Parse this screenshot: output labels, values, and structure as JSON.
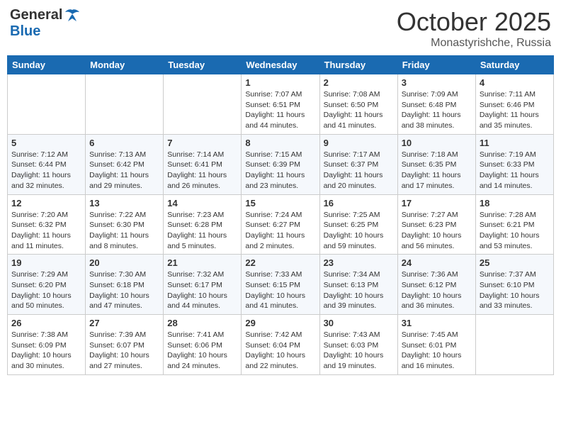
{
  "header": {
    "logo_general": "General",
    "logo_blue": "Blue",
    "month": "October 2025",
    "location": "Monastyrishche, Russia"
  },
  "days_of_week": [
    "Sunday",
    "Monday",
    "Tuesday",
    "Wednesday",
    "Thursday",
    "Friday",
    "Saturday"
  ],
  "weeks": [
    [
      {
        "day": "",
        "info": ""
      },
      {
        "day": "",
        "info": ""
      },
      {
        "day": "",
        "info": ""
      },
      {
        "day": "1",
        "info": "Sunrise: 7:07 AM\nSunset: 6:51 PM\nDaylight: 11 hours and 44 minutes."
      },
      {
        "day": "2",
        "info": "Sunrise: 7:08 AM\nSunset: 6:50 PM\nDaylight: 11 hours and 41 minutes."
      },
      {
        "day": "3",
        "info": "Sunrise: 7:09 AM\nSunset: 6:48 PM\nDaylight: 11 hours and 38 minutes."
      },
      {
        "day": "4",
        "info": "Sunrise: 7:11 AM\nSunset: 6:46 PM\nDaylight: 11 hours and 35 minutes."
      }
    ],
    [
      {
        "day": "5",
        "info": "Sunrise: 7:12 AM\nSunset: 6:44 PM\nDaylight: 11 hours and 32 minutes."
      },
      {
        "day": "6",
        "info": "Sunrise: 7:13 AM\nSunset: 6:42 PM\nDaylight: 11 hours and 29 minutes."
      },
      {
        "day": "7",
        "info": "Sunrise: 7:14 AM\nSunset: 6:41 PM\nDaylight: 11 hours and 26 minutes."
      },
      {
        "day": "8",
        "info": "Sunrise: 7:15 AM\nSunset: 6:39 PM\nDaylight: 11 hours and 23 minutes."
      },
      {
        "day": "9",
        "info": "Sunrise: 7:17 AM\nSunset: 6:37 PM\nDaylight: 11 hours and 20 minutes."
      },
      {
        "day": "10",
        "info": "Sunrise: 7:18 AM\nSunset: 6:35 PM\nDaylight: 11 hours and 17 minutes."
      },
      {
        "day": "11",
        "info": "Sunrise: 7:19 AM\nSunset: 6:33 PM\nDaylight: 11 hours and 14 minutes."
      }
    ],
    [
      {
        "day": "12",
        "info": "Sunrise: 7:20 AM\nSunset: 6:32 PM\nDaylight: 11 hours and 11 minutes."
      },
      {
        "day": "13",
        "info": "Sunrise: 7:22 AM\nSunset: 6:30 PM\nDaylight: 11 hours and 8 minutes."
      },
      {
        "day": "14",
        "info": "Sunrise: 7:23 AM\nSunset: 6:28 PM\nDaylight: 11 hours and 5 minutes."
      },
      {
        "day": "15",
        "info": "Sunrise: 7:24 AM\nSunset: 6:27 PM\nDaylight: 11 hours and 2 minutes."
      },
      {
        "day": "16",
        "info": "Sunrise: 7:25 AM\nSunset: 6:25 PM\nDaylight: 10 hours and 59 minutes."
      },
      {
        "day": "17",
        "info": "Sunrise: 7:27 AM\nSunset: 6:23 PM\nDaylight: 10 hours and 56 minutes."
      },
      {
        "day": "18",
        "info": "Sunrise: 7:28 AM\nSunset: 6:21 PM\nDaylight: 10 hours and 53 minutes."
      }
    ],
    [
      {
        "day": "19",
        "info": "Sunrise: 7:29 AM\nSunset: 6:20 PM\nDaylight: 10 hours and 50 minutes."
      },
      {
        "day": "20",
        "info": "Sunrise: 7:30 AM\nSunset: 6:18 PM\nDaylight: 10 hours and 47 minutes."
      },
      {
        "day": "21",
        "info": "Sunrise: 7:32 AM\nSunset: 6:17 PM\nDaylight: 10 hours and 44 minutes."
      },
      {
        "day": "22",
        "info": "Sunrise: 7:33 AM\nSunset: 6:15 PM\nDaylight: 10 hours and 41 minutes."
      },
      {
        "day": "23",
        "info": "Sunrise: 7:34 AM\nSunset: 6:13 PM\nDaylight: 10 hours and 39 minutes."
      },
      {
        "day": "24",
        "info": "Sunrise: 7:36 AM\nSunset: 6:12 PM\nDaylight: 10 hours and 36 minutes."
      },
      {
        "day": "25",
        "info": "Sunrise: 7:37 AM\nSunset: 6:10 PM\nDaylight: 10 hours and 33 minutes."
      }
    ],
    [
      {
        "day": "26",
        "info": "Sunrise: 7:38 AM\nSunset: 6:09 PM\nDaylight: 10 hours and 30 minutes."
      },
      {
        "day": "27",
        "info": "Sunrise: 7:39 AM\nSunset: 6:07 PM\nDaylight: 10 hours and 27 minutes."
      },
      {
        "day": "28",
        "info": "Sunrise: 7:41 AM\nSunset: 6:06 PM\nDaylight: 10 hours and 24 minutes."
      },
      {
        "day": "29",
        "info": "Sunrise: 7:42 AM\nSunset: 6:04 PM\nDaylight: 10 hours and 22 minutes."
      },
      {
        "day": "30",
        "info": "Sunrise: 7:43 AM\nSunset: 6:03 PM\nDaylight: 10 hours and 19 minutes."
      },
      {
        "day": "31",
        "info": "Sunrise: 7:45 AM\nSunset: 6:01 PM\nDaylight: 10 hours and 16 minutes."
      },
      {
        "day": "",
        "info": ""
      }
    ]
  ]
}
